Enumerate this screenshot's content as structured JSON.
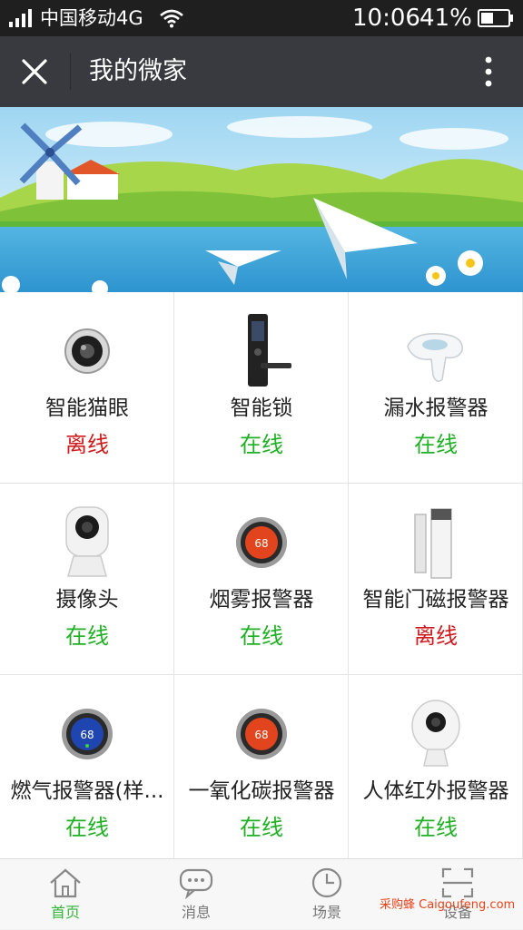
{
  "status_bar": {
    "carrier": "中国移动4G",
    "time": "10:06",
    "battery": "41%"
  },
  "header": {
    "title": "我的微家",
    "close_icon": "close-icon",
    "more_icon": "more-vertical-icon"
  },
  "devices": [
    {
      "name": "智能猫眼",
      "status": "离线",
      "status_color": "#d0191c",
      "icon": "peephole-camera-icon"
    },
    {
      "name": "智能锁",
      "status": "在线",
      "status_color": "#1fb024",
      "icon": "smart-lock-icon"
    },
    {
      "name": "漏水报警器",
      "status": "在线",
      "status_color": "#1fb024",
      "icon": "water-leak-sensor-icon"
    },
    {
      "name": "摄像头",
      "status": "在线",
      "status_color": "#1fb024",
      "icon": "camera-icon"
    },
    {
      "name": "烟雾报警器",
      "status": "在线",
      "status_color": "#1fb024",
      "icon": "smoke-alarm-icon"
    },
    {
      "name": "智能门磁报警器",
      "status": "离线",
      "status_color": "#d0191c",
      "icon": "door-sensor-icon"
    },
    {
      "name": "燃气报警器(样...",
      "status": "在线",
      "status_color": "#1fb024",
      "icon": "gas-alarm-icon"
    },
    {
      "name": "一氧化碳报警器",
      "status": "在线",
      "status_color": "#1fb024",
      "icon": "co-alarm-icon"
    },
    {
      "name": "人体红外报警器",
      "status": "在线",
      "status_color": "#1fb024",
      "icon": "motion-sensor-icon"
    }
  ],
  "thermostat_reading": "68",
  "tabs": [
    {
      "label": "首页",
      "icon": "home-icon",
      "active": true
    },
    {
      "label": "消息",
      "icon": "message-icon",
      "active": false
    },
    {
      "label": "场景",
      "icon": "clock-icon",
      "active": false
    },
    {
      "label": "设备",
      "icon": "scan-icon",
      "active": false
    }
  ],
  "watermark": "采购蜂 Caigoufeng.com",
  "colors": {
    "accent": "#34b53a",
    "online": "#1fb024",
    "offline": "#d0191c",
    "header_bg": "#393a3f"
  }
}
